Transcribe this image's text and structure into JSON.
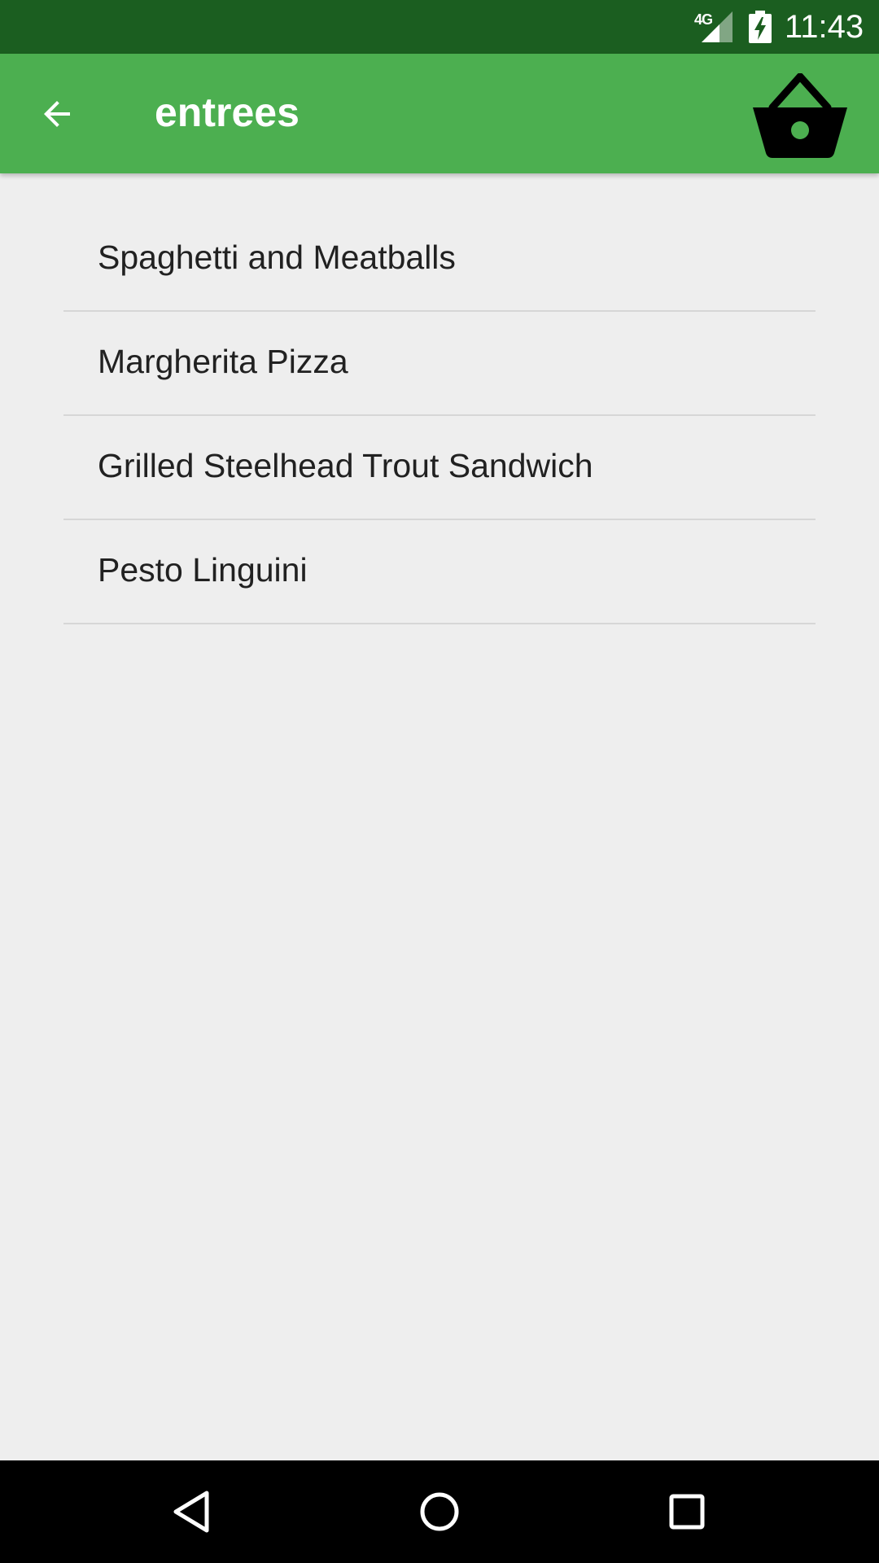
{
  "status_bar": {
    "network": "4G",
    "time": "11:43",
    "icons": [
      "signal-icon",
      "battery-charging-icon"
    ]
  },
  "app_bar": {
    "title": "entrees",
    "back_icon": "arrow-back-icon",
    "cart_icon": "shopping-basket-icon",
    "background_color": "#4caf50"
  },
  "list": {
    "items": [
      {
        "label": "Spaghetti and Meatballs"
      },
      {
        "label": "Margherita Pizza"
      },
      {
        "label": "Grilled Steelhead Trout Sandwich"
      },
      {
        "label": "Pesto Linguini"
      }
    ]
  },
  "nav_bar": {
    "icons": [
      "back-triangle-icon",
      "home-circle-icon",
      "recents-square-icon"
    ]
  },
  "colors": {
    "status_bar": "#1b5e20",
    "app_bar": "#4caf50",
    "background": "#eeeeee"
  }
}
